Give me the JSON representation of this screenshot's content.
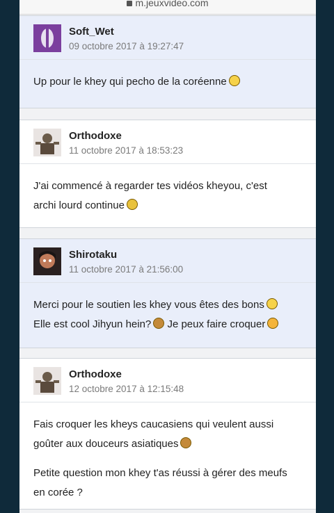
{
  "browser": {
    "url": "m.jeuxvideo.com"
  },
  "posts": [
    {
      "author": "Soft_Wet",
      "date": "09 octobre 2017 à 19:27:47",
      "lines": [
        "Up pour le khey qui pecho de la coréenne"
      ],
      "avatar_color": "#7b3f9e"
    },
    {
      "author": "Orthodoxe",
      "date": "11 octobre 2017 à 18:53:23",
      "lines": [
        "J'ai commencé à regarder tes vidéos kheyou, c'est",
        "archi lourd continue"
      ],
      "avatar_color": "#6b5b4a"
    },
    {
      "author": "Shirotaku",
      "date": "11 octobre 2017 à 21:56:00",
      "lines": [
        "Merci pour le soutien les khey vous êtes des bons",
        "Elle est cool Jihyun hein?",
        "Je peux faire croquer"
      ],
      "avatar_color": "#3a2a28"
    },
    {
      "author": "Orthodoxe",
      "date": "12 octobre 2017 à 12:15:48",
      "lines": [
        "Fais croquer les kheys caucasiens qui veulent aussi",
        "goûter aux douceurs asiatiques",
        "Petite question mon khey t'as réussi à gérer des meufs",
        "en corée ?"
      ],
      "avatar_color": "#6b5b4a"
    }
  ]
}
